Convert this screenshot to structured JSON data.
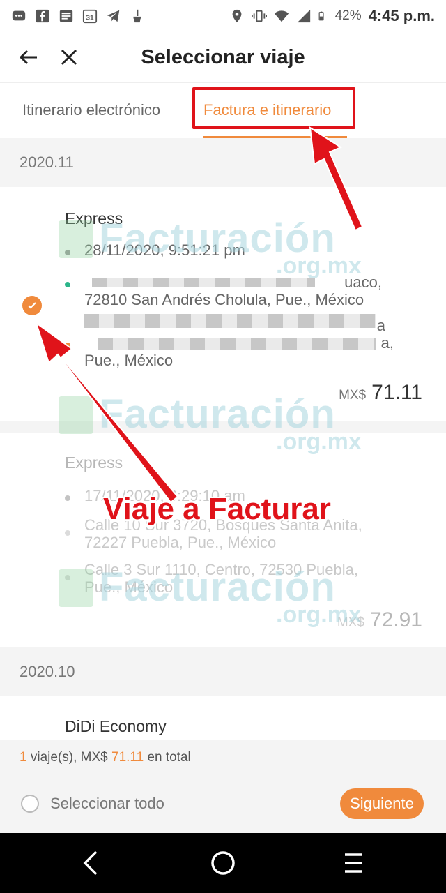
{
  "status_bar": {
    "battery": "42%",
    "time": "4:45 p.m.",
    "calendar_day": "31",
    "icons": [
      "chat-icon",
      "facebook-icon",
      "news-icon",
      "calendar-icon",
      "telegram-icon",
      "brush-icon",
      "location-icon",
      "vibrate-icon",
      "wifi-icon",
      "signal-icon",
      "battery-icon"
    ]
  },
  "header": {
    "title": "Seleccionar viaje"
  },
  "tabs": [
    {
      "label": "Itinerario electrónico",
      "active": false
    },
    {
      "label": "Factura e itinerario",
      "active": true
    }
  ],
  "sections": [
    {
      "date": "2020.11",
      "trips": [
        {
          "type": "Express",
          "datetime": "28/11/2020, 9:51:21 pm",
          "origin_visible_end": "uaco,",
          "origin_line2": "72810 San Andrés Cholula, Pue., México",
          "dest_visible_end1": "a",
          "dest_visible_end2": "a,",
          "dest_line3": "Pue., México",
          "currency": "MX$",
          "price": "71.11",
          "selected": true
        },
        {
          "type": "Express",
          "datetime": "17/11/2020, 6:29:10 am",
          "origin_line1": "Calle 10 Sur 3720, Bosques Santa Anita,",
          "origin_line2": "72227 Puebla, Pue., México",
          "dest_line1": "Calle 3 Sur 1110, Centro, 72530 Puebla,",
          "dest_line2": "Pue., México",
          "currency": "MX$",
          "price": "72.91",
          "selected": false
        }
      ]
    },
    {
      "date": "2020.10",
      "trips": [
        {
          "type": "DiDi Economy"
        }
      ]
    }
  ],
  "summary": {
    "count": "1",
    "count_suffix": " viaje(s), MX$ ",
    "amount": "71.11",
    "suffix": " en total"
  },
  "footer": {
    "select_all": "Seleccionar todo",
    "next": "Siguiente"
  },
  "annotation": {
    "text": "Viaje a Facturar"
  },
  "watermark": {
    "text": "Facturación",
    "sub": ".org.mx"
  },
  "colors": {
    "accent": "#f08a3c",
    "annotation_red": "#e0131a"
  }
}
